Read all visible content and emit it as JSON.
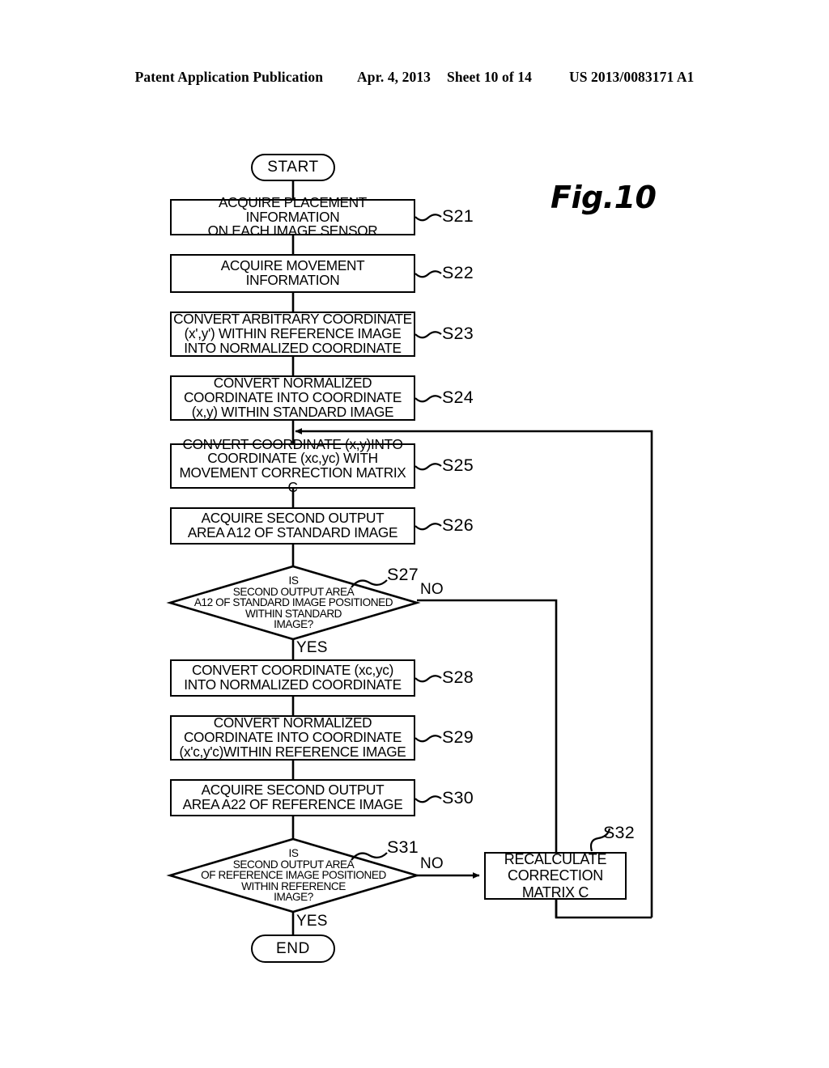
{
  "header": {
    "publication": "Patent Application Publication",
    "date": "Apr. 4, 2013",
    "sheet": "Sheet 10 of 14",
    "number": "US 2013/0083171 A1"
  },
  "figure": {
    "label": "Fig.10"
  },
  "flowchart": {
    "start": {
      "label": "START"
    },
    "end": {
      "label": "END"
    },
    "steps": [
      {
        "id": "S21",
        "ref": "S21",
        "lines": [
          "ACQUIRE PLACEMENT INFORMATION",
          "ON EACH IMAGE SENSOR"
        ]
      },
      {
        "id": "S22",
        "ref": "S22",
        "lines": [
          "ACQUIRE MOVEMENT",
          "INFORMATION"
        ]
      },
      {
        "id": "S23",
        "ref": "S23",
        "lines": [
          "CONVERT ARBITRARY COORDINATE",
          "(x',y') WITHIN REFERENCE IMAGE",
          "INTO NORMALIZED COORDINATE"
        ]
      },
      {
        "id": "S24",
        "ref": "S24",
        "lines": [
          "CONVERT NORMALIZED",
          "COORDINATE INTO COORDINATE",
          "(x,y) WITHIN STANDARD IMAGE"
        ]
      },
      {
        "id": "S25",
        "ref": "S25",
        "lines": [
          "CONVERT COORDINATE (x,y)INTO",
          "COORDINATE (xc,yc) WITH",
          "MOVEMENT CORRECTION MATRIX C"
        ]
      },
      {
        "id": "S26",
        "ref": "S26",
        "lines": [
          "ACQUIRE SECOND OUTPUT",
          "AREA A12 OF STANDARD IMAGE"
        ]
      },
      {
        "id": "S28",
        "ref": "S28",
        "lines": [
          "CONVERT COORDINATE (xc,yc)",
          "INTO NORMALIZED COORDINATE"
        ]
      },
      {
        "id": "S29",
        "ref": "S29",
        "lines": [
          "CONVERT NORMALIZED",
          "COORDINATE INTO COORDINATE",
          "(x'c,y'c)WITHIN REFERENCE IMAGE"
        ]
      },
      {
        "id": "S30",
        "ref": "S30",
        "lines": [
          "ACQUIRE SECOND OUTPUT",
          "AREA A22 OF REFERENCE IMAGE"
        ]
      },
      {
        "id": "S32",
        "ref": "S32",
        "lines": [
          "RECALCULATE",
          "CORRECTION",
          "MATRIX C"
        ]
      }
    ],
    "decisions": [
      {
        "id": "S27",
        "ref": "S27",
        "lines": [
          "IS",
          "SECOND OUTPUT AREA",
          "A12 OF STANDARD IMAGE POSITIONED",
          "WITHIN STANDARD",
          "IMAGE?"
        ],
        "yes_label": "YES",
        "no_label": "NO"
      },
      {
        "id": "S31",
        "ref": "S31",
        "lines": [
          "IS",
          "SECOND OUTPUT AREA",
          "OF REFERENCE IMAGE POSITIONED",
          "WITHIN REFERENCE",
          "IMAGE?"
        ],
        "yes_label": "YES",
        "no_label": "NO"
      }
    ]
  }
}
